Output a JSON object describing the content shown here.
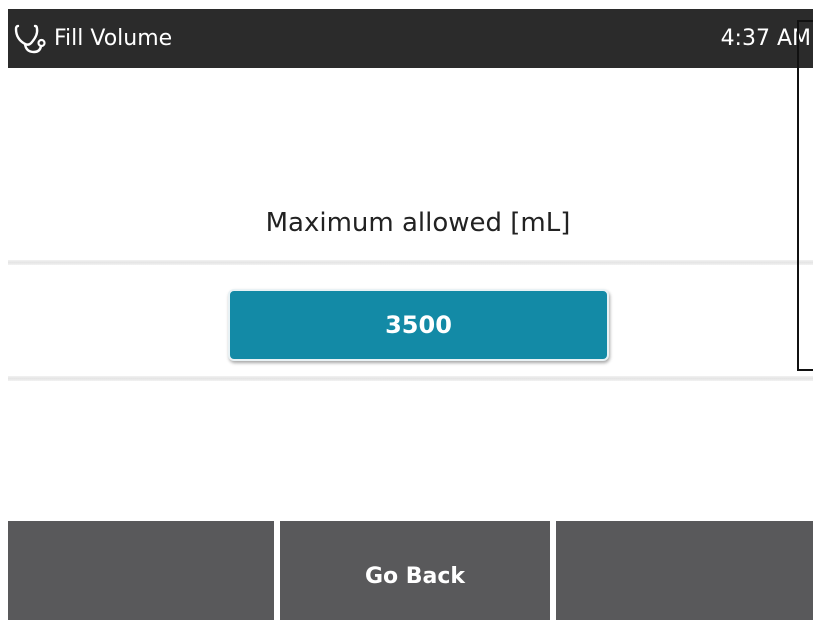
{
  "header": {
    "icon": "stethoscope-icon",
    "title": "Fill Volume",
    "time": "4:37 AM"
  },
  "setting": {
    "label": "Maximum allowed [mL]",
    "value": "3500"
  },
  "softkeys": {
    "left_label": "",
    "center_label": "Go Back",
    "right_label": ""
  },
  "colors": {
    "header_bg": "#2b2b2b",
    "value_button": "#138aa6",
    "softkey_bg": "#59595b"
  }
}
